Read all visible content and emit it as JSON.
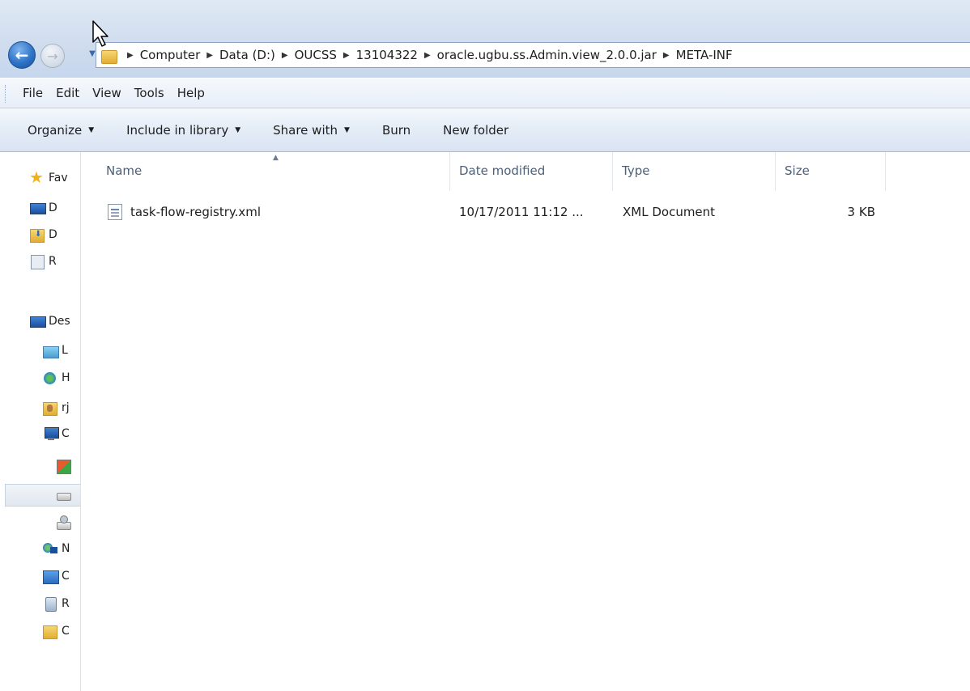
{
  "breadcrumb": {
    "segments": [
      "Computer",
      "Data (D:)",
      "OUCSS",
      "13104322",
      "oracle.ugbu.ss.Admin.view_2.0.0.jar",
      "META-INF"
    ]
  },
  "menu": {
    "items": [
      "File",
      "Edit",
      "View",
      "Tools",
      "Help"
    ]
  },
  "toolbar": {
    "organize": "Organize",
    "include_in_library": "Include in library",
    "share_with": "Share with",
    "burn": "Burn",
    "new_folder": "New folder"
  },
  "navigation": {
    "items": [
      {
        "label": "Fav",
        "icon": "star-icon"
      },
      {
        "label": "D",
        "icon": "desktop-icon"
      },
      {
        "label": "D",
        "icon": "downloads-folder-icon"
      },
      {
        "label": "R",
        "icon": "recent-places-icon"
      },
      {
        "label": "Des",
        "icon": "desktop-icon"
      },
      {
        "label": "L",
        "icon": "libraries-icon"
      },
      {
        "label": "H",
        "icon": "homegroup-icon"
      },
      {
        "label": "rj",
        "icon": "user-folder-icon"
      },
      {
        "label": "C",
        "icon": "computer-icon"
      },
      {
        "label": "",
        "icon": "windows-drive-icon"
      },
      {
        "label": "",
        "icon": "drive-icon"
      },
      {
        "label": "",
        "icon": "network-drive-icon"
      },
      {
        "label": "N",
        "icon": "network-icon"
      },
      {
        "label": "C",
        "icon": "control-panel-icon"
      },
      {
        "label": "R",
        "icon": "recycle-bin-icon"
      },
      {
        "label": "C",
        "icon": "folder-icon"
      }
    ]
  },
  "columns": {
    "name": "Name",
    "date_modified": "Date modified",
    "type": "Type",
    "size": "Size"
  },
  "files": [
    {
      "name": "task-flow-registry.xml",
      "date_modified": "10/17/2011 11:12 ...",
      "type": "XML Document",
      "size": "3 KB",
      "icon": "xml-file-icon"
    }
  ],
  "colors": {
    "chrome_top": "#dfe9f5",
    "toolbar_bg": "#e4ecf7",
    "column_header_text": "#4c607a",
    "content_bg": "#ffffff"
  }
}
